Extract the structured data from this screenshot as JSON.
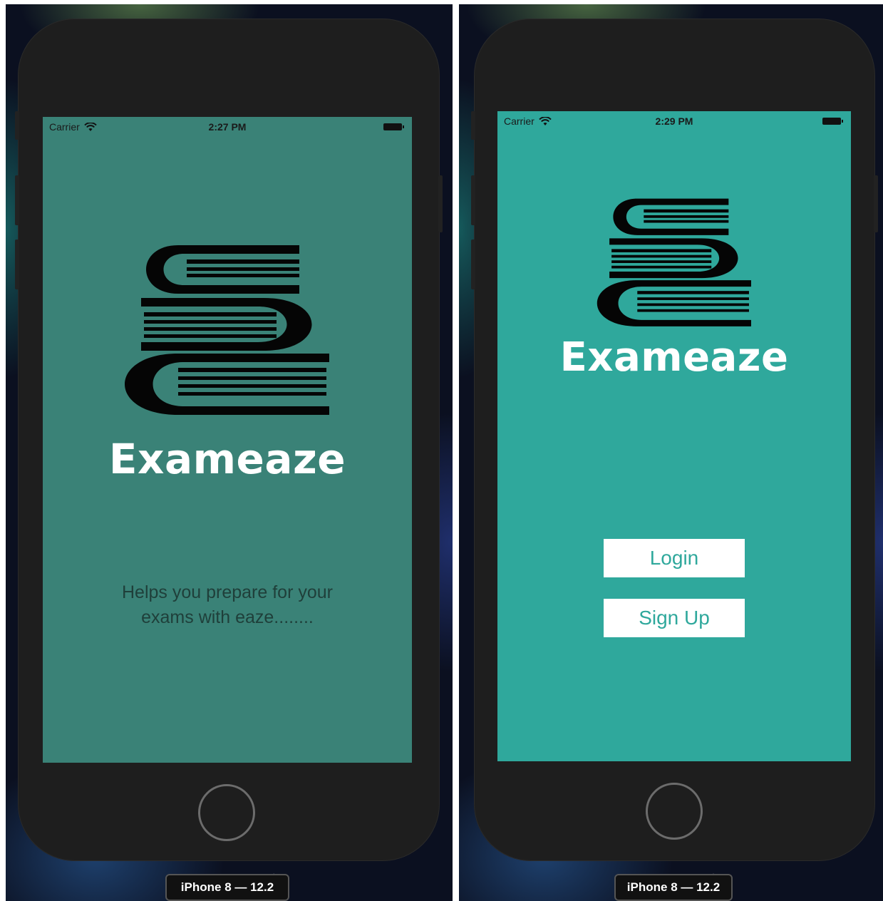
{
  "screens": [
    {
      "status": {
        "carrier": "Carrier",
        "time": "2:27 PM"
      },
      "app_name": "Exameaze",
      "tagline_line1": "Helps you prepare for your",
      "tagline_line2": "exams with eaze........",
      "screen_color": "#3a8277",
      "device_label": "iPhone 8 — 12.2"
    },
    {
      "status": {
        "carrier": "Carrier",
        "time": "2:29 PM"
      },
      "app_name": "Exameaze",
      "buttons": {
        "login": "Login",
        "signup": "Sign Up"
      },
      "screen_color": "#2fa89c",
      "device_label": "iPhone 8 — 12.2"
    }
  ],
  "icons": [
    "wifi-icon",
    "battery-icon",
    "books-stack-logo",
    "home-button"
  ]
}
